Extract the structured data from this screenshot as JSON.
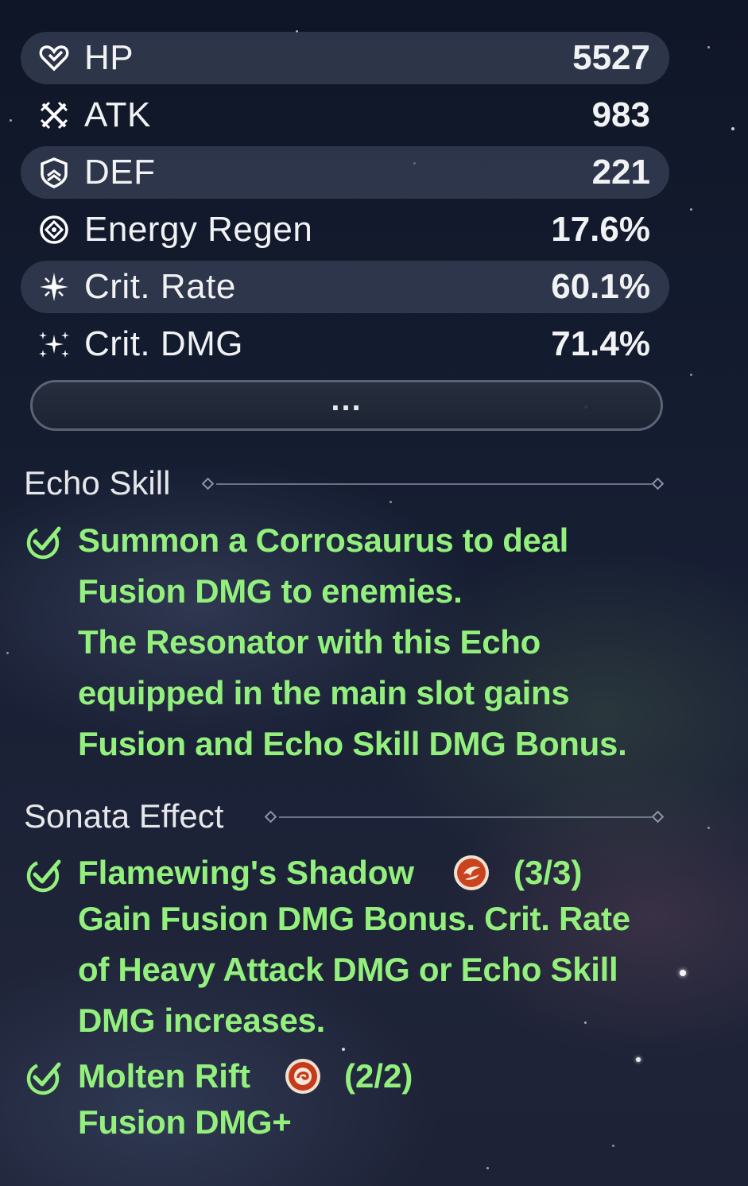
{
  "stats": [
    {
      "icon": "heart-icon",
      "label": "HP",
      "value": "5527"
    },
    {
      "icon": "crossed-swords-icon",
      "label": "ATK",
      "value": "983"
    },
    {
      "icon": "shield-icon",
      "label": "DEF",
      "value": "221"
    },
    {
      "icon": "energy-regen-icon",
      "label": "Energy Regen",
      "value": "17.6%"
    },
    {
      "icon": "sparkle-icon",
      "label": "Crit. Rate",
      "value": "60.1%"
    },
    {
      "icon": "multi-sparkle-icon",
      "label": "Crit. DMG",
      "value": "71.4%"
    }
  ],
  "more_button": "...",
  "echo_skill": {
    "title": "Echo Skill",
    "lines": [
      "Summon a Corrosaurus to deal",
      "Fusion DMG to enemies.",
      "The Resonator with this Echo",
      "equipped in the main slot gains",
      "Fusion and Echo Skill DMG Bonus."
    ]
  },
  "sonata_effect": {
    "title": "Sonata Effect",
    "sets": [
      {
        "name": "Flamewing's Shadow",
        "count": "(3/3)",
        "icon": "flamewing-icon",
        "lines": [
          "Gain Fusion DMG Bonus. Crit. Rate",
          "of Heavy Attack DMG or Echo Skill",
          "DMG increases."
        ]
      },
      {
        "name": "Molten Rift",
        "count": "(2/2)",
        "icon": "molten-rift-icon",
        "lines": [
          "Fusion DMG+"
        ]
      }
    ]
  },
  "colors": {
    "effect_text": "#93f07c",
    "stat_text": "#f1f2f4",
    "row_shade": "#464e64"
  }
}
